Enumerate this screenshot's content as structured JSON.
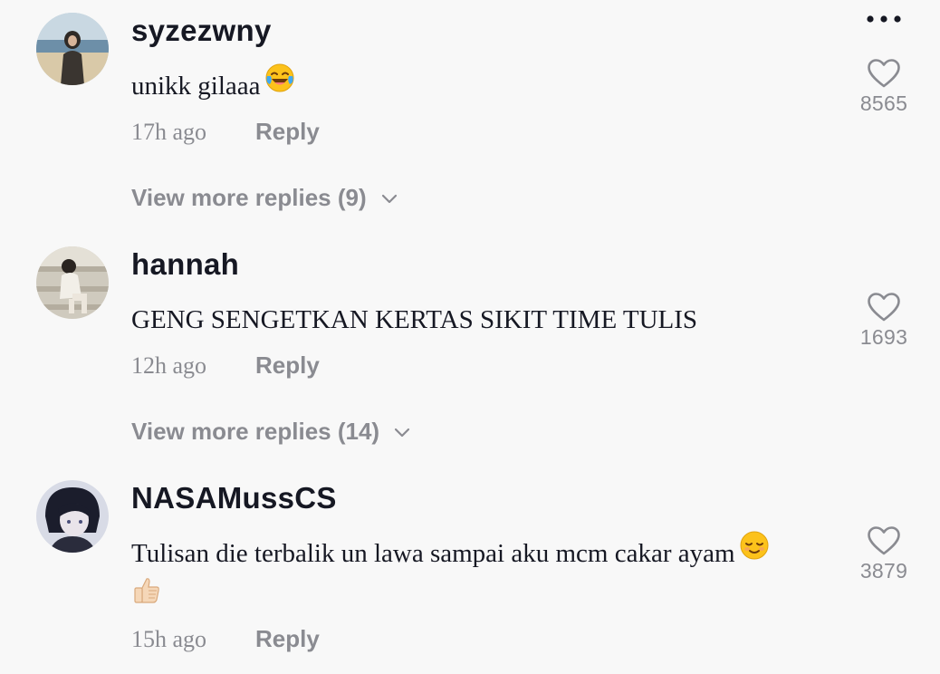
{
  "comments": [
    {
      "username": "syzezwny",
      "text": "unikk gilaaa",
      "emoji": "laughing-tears-emoji",
      "time": "17h ago",
      "reply_label": "Reply",
      "view_replies": "View more replies (9)",
      "like_count": "8565"
    },
    {
      "username": "hannah",
      "text": "GENG SENGETKAN KERTAS SIKIT TIME TULIS",
      "time": "12h ago",
      "reply_label": "Reply",
      "view_replies": "View more replies (14)",
      "like_count": "1693"
    },
    {
      "username": "NASAMussCS",
      "text": "Tulisan die terbalik un lawa sampai aku mcm cakar ayam",
      "emoji": "relieved-face-emoji",
      "emoji2": "thumbs-up-emoji",
      "time": "15h ago",
      "reply_label": "Reply",
      "like_count": "3879"
    }
  ],
  "icons": {
    "more": "more-horizontal-icon",
    "like": "heart-outline-icon",
    "expand": "chevron-down-icon"
  },
  "colors": {
    "background": "#f8f8f8",
    "primary_text": "#161823",
    "secondary_text": "#8a8b91"
  }
}
